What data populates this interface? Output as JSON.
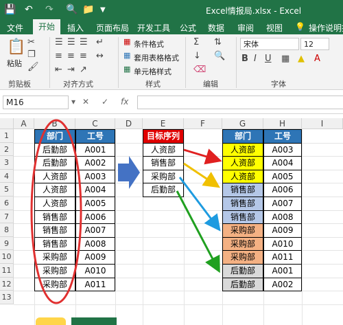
{
  "window": {
    "title": "Excel情报局.xlsx  -  Excel"
  },
  "tabs": [
    "文件",
    "开始",
    "插入",
    "页面布局",
    "开发工具",
    "公式",
    "数据",
    "审阅",
    "视图",
    "操作说明搜"
  ],
  "ribbon": {
    "groups": [
      "剪贴板",
      "对齐方式",
      "样式",
      "编辑",
      "字体"
    ],
    "paste_label": "粘贴",
    "style_items": [
      "条件格式",
      "套用表格格式",
      "单元格样式"
    ],
    "font_name": "宋体",
    "font_size": "12"
  },
  "formula_bar": {
    "name_box": "M16",
    "fx": "fx",
    "formula": ""
  },
  "columns": [
    "A",
    "B",
    "C",
    "D",
    "E",
    "F",
    "G",
    "H",
    "I"
  ],
  "rows": [
    "1",
    "2",
    "3",
    "4",
    "5",
    "6",
    "7",
    "8",
    "9",
    "10",
    "11",
    "12",
    "13"
  ],
  "left_table": {
    "headers": [
      "部门",
      "工号"
    ],
    "rows": [
      [
        "后勤部",
        "A001"
      ],
      [
        "后勤部",
        "A002"
      ],
      [
        "人资部",
        "A003"
      ],
      [
        "人资部",
        "A004"
      ],
      [
        "人资部",
        "A005"
      ],
      [
        "销售部",
        "A006"
      ],
      [
        "销售部",
        "A007"
      ],
      [
        "销售部",
        "A008"
      ],
      [
        "采购部",
        "A009"
      ],
      [
        "采购部",
        "A010"
      ],
      [
        "采购部",
        "A011"
      ]
    ]
  },
  "order_table": {
    "header": "目标序列",
    "items": [
      "人资部",
      "销售部",
      "采购部",
      "后勤部"
    ]
  },
  "right_table": {
    "headers": [
      "部门",
      "工号"
    ],
    "rows": [
      [
        "人资部",
        "A003"
      ],
      [
        "人资部",
        "A004"
      ],
      [
        "人资部",
        "A005"
      ],
      [
        "销售部",
        "A006"
      ],
      [
        "销售部",
        "A007"
      ],
      [
        "销售部",
        "A008"
      ],
      [
        "采购部",
        "A009"
      ],
      [
        "采购部",
        "A010"
      ],
      [
        "采购部",
        "A011"
      ],
      [
        "后勤部",
        "A001"
      ],
      [
        "后勤部",
        "A002"
      ]
    ]
  },
  "colors": {
    "excel_green": "#217346",
    "header_blue": "#2e75b6",
    "order_header_red": "#e00000",
    "renzi_yellow": "#ffff00",
    "xiaoshou_blue": "#b4c7e7",
    "caigou_orange": "#f4b183",
    "houqin_gray": "#d9d9d9",
    "ellipse_red": "#e03030",
    "arrow_block_blue": "#4472c4"
  }
}
